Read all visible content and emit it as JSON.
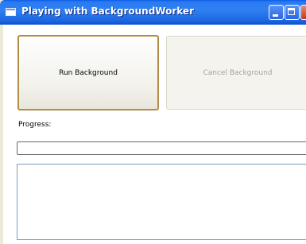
{
  "window": {
    "title": "Playing with BackgroundWorker",
    "titlebar_color": "#2f80f2"
  },
  "controls": {
    "run_label": "Run Background",
    "cancel_label": "Cancel Background",
    "cancel_enabled": false
  },
  "progress": {
    "label": "Progress:",
    "value_percent": 0
  },
  "output": {
    "text": ""
  },
  "icons": {
    "app": "window-app-icon",
    "minimize": "minimize-icon",
    "maximize": "maximize-icon",
    "close": "close-icon"
  }
}
